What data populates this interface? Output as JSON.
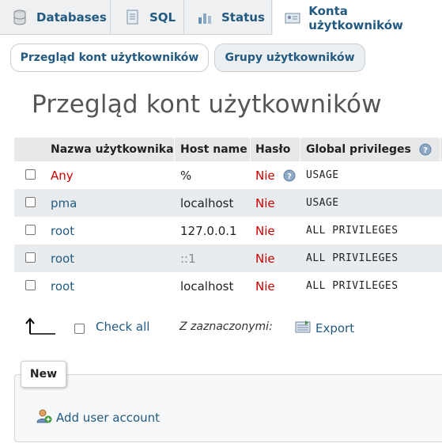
{
  "tabs": [
    {
      "label": "Databases",
      "icon": "database-icon"
    },
    {
      "label": "SQL",
      "icon": "sql-icon"
    },
    {
      "label": "Status",
      "icon": "status-chart-icon"
    },
    {
      "label": "Konta użytkowników",
      "icon": "user-accounts-icon"
    }
  ],
  "subtabs": [
    {
      "label": "Przegląd kont użytkowników"
    },
    {
      "label": "Grupy użytkowników"
    }
  ],
  "page_title": "Przegląd kont użytkowników",
  "table": {
    "headers": [
      "Nazwa użytkownika",
      "Host name",
      "Hasło",
      "Global privileges"
    ],
    "rows": [
      {
        "user": "Any",
        "host": "%",
        "password": "Nie",
        "privileges": "USAGE"
      },
      {
        "user": "pma",
        "host": "localhost",
        "password": "Nie",
        "privileges": "USAGE"
      },
      {
        "user": "root",
        "host": "127.0.0.1",
        "password": "Nie",
        "privileges": "ALL PRIVILEGES"
      },
      {
        "user": "root",
        "host": "::1",
        "password": "Nie",
        "privileges": "ALL PRIVILEGES"
      },
      {
        "user": "root",
        "host": "localhost",
        "password": "Nie",
        "privileges": "ALL PRIVILEGES"
      }
    ]
  },
  "actions": {
    "check_all": "Check all",
    "with_selected": "Z zaznaczonymi:",
    "export": "Export"
  },
  "new_section": {
    "legend": "New",
    "add_user": "Add user account"
  },
  "colors": {
    "link": "#235a81",
    "negative": "#cc0000",
    "header_bg": "#e6e8ea",
    "alt_row_bg": "#e9ecee"
  }
}
